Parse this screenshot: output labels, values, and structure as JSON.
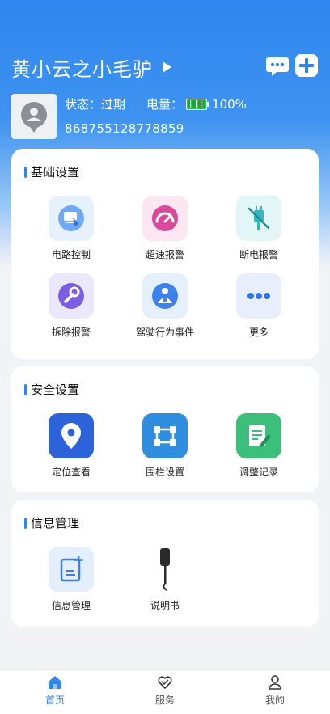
{
  "header": {
    "device_name": "黄小云之小毛驴",
    "status_label": "状态：",
    "status_value": "过期",
    "battery_label": "电量：",
    "battery_value": "100%",
    "device_id": "868755128778859"
  },
  "sections": {
    "basic": {
      "title": "基础设置",
      "items": [
        "电路控制",
        "超速报警",
        "断电报警",
        "拆除报警",
        "驾驶行为事件",
        "更多"
      ]
    },
    "security": {
      "title": "安全设置",
      "items": [
        "定位查看",
        "围栏设置",
        "调整记录"
      ]
    },
    "info": {
      "title": "信息管理",
      "items": [
        "信息管理",
        "说明书"
      ]
    }
  },
  "nav": {
    "items": [
      "首页",
      "服务",
      "我的"
    ],
    "active": "首页"
  },
  "colors": {
    "accent": "#2f86ee",
    "battery": "#2dbf4a"
  }
}
